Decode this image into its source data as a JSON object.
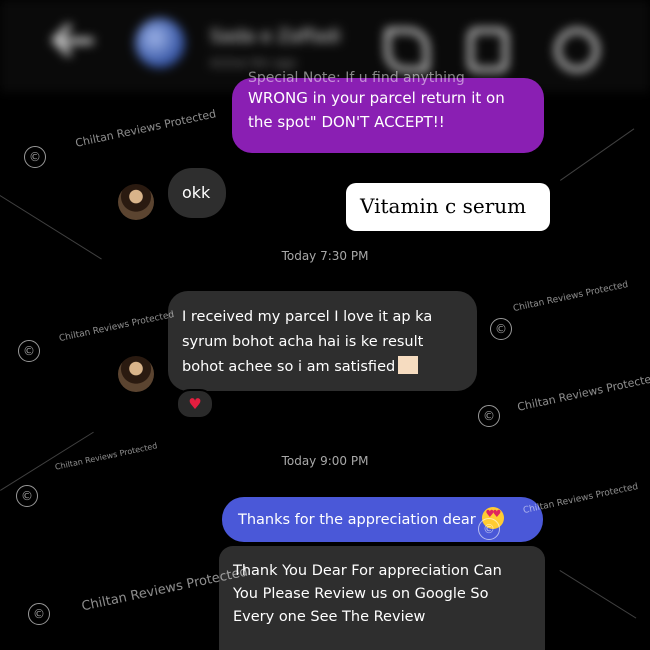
{
  "header": {
    "contact_name": "Sada e Zaffadi",
    "status": "Active 9m ago"
  },
  "messages": {
    "partial_top": "Special Note: If u find anything",
    "purple_line1": "WRONG in your parcel return it on",
    "purple_line2": "the spot\" DON'T ACCEPT!!",
    "okk": "okk",
    "label": "Vitamin c serum",
    "time1": "Today 7:30 PM",
    "received_line1": "I received my parcel I love it ap ka",
    "received_line2": "syrum bohot acha hai is ke result",
    "received_line3": "bohot achee so i am satisfied",
    "reaction": "♥",
    "time2": "Today 9:00 PM",
    "thanks": "Thanks for the appreciation dear",
    "review_line1": "Thank You Dear For appreciation Can",
    "review_line2": "You Please Review us on Google So",
    "review_line3": "Every one See The Review"
  },
  "watermark": {
    "text": "Chiltan Reviews Protected",
    "symbol": "©"
  },
  "colors": {
    "purple_bubble": "#8a1fb3",
    "blue_bubble": "#4a58d8",
    "gray_bubble": "#2e2e2e",
    "heart": "#e41e3f"
  }
}
